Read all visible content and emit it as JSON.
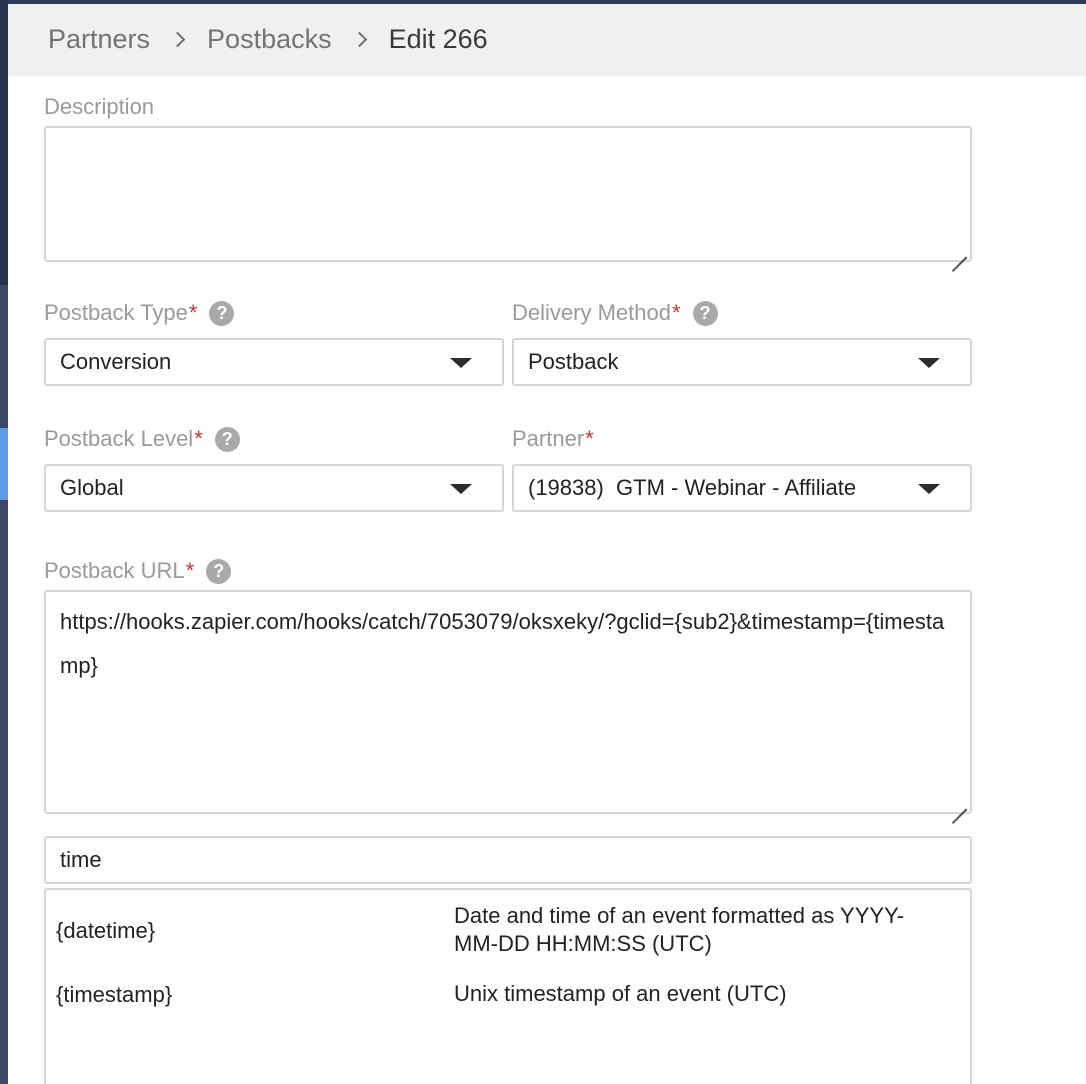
{
  "breadcrumb": {
    "items": [
      "Partners",
      "Postbacks"
    ],
    "current": "Edit 266"
  },
  "description": {
    "label": "Description",
    "value": ""
  },
  "postback_type": {
    "label": "Postback Type",
    "required_mark": "*",
    "help": "?",
    "value": "Conversion"
  },
  "delivery_method": {
    "label": "Delivery Method",
    "required_mark": "*",
    "help": "?",
    "value": "Postback"
  },
  "postback_level": {
    "label": "Postback Level",
    "required_mark": "*",
    "help": "?",
    "value": "Global"
  },
  "partner": {
    "label": "Partner",
    "required_mark": "*",
    "value": "(19838)  GTM - Webinar - Affiliate"
  },
  "postback_url": {
    "label": "Postback URL",
    "required_mark": "*",
    "help": "?",
    "value": "https://hooks.zapier.com/hooks/catch/7053079/oksxeky/?gclid={sub2}&timestamp={timestamp}"
  },
  "macro_search": {
    "value": "time"
  },
  "macros": [
    {
      "token": "{datetime}",
      "description": "Date and time of an event formatted as YYYY-MM-DD HH:MM:SS (UTC)"
    },
    {
      "token": "{timestamp}",
      "description": "Unix timestamp of an event (UTC)"
    }
  ],
  "colors": {
    "required": "#d0342c",
    "sidebar": "#2e3a56",
    "sidebar_active": "#5d9be8"
  }
}
